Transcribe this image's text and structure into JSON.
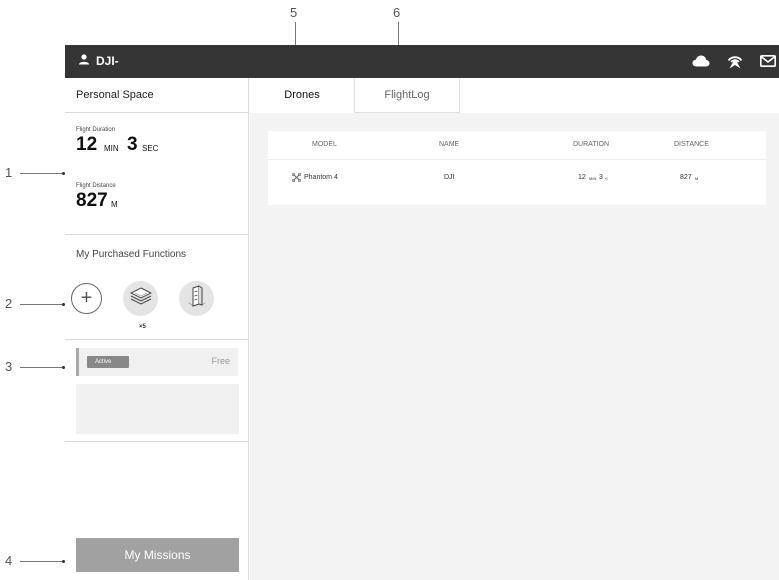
{
  "callouts": [
    "1",
    "2",
    "3",
    "4",
    "5",
    "6"
  ],
  "topbar": {
    "username": "DJI-",
    "icons": [
      "user-icon",
      "cloud-icon",
      "signal-icon",
      "mail-icon"
    ]
  },
  "sidebar": {
    "title": "Personal Space",
    "flight_duration": {
      "label": "Flight Duration",
      "minutes": "12",
      "min_unit": "MIN",
      "seconds": "3",
      "sec_unit": "SEC"
    },
    "flight_distance": {
      "label": "Flight Distance",
      "value": "827",
      "unit": "M"
    },
    "purchased_title": "My Purchased Functions",
    "purchased_count": "×5",
    "active_badge": "Active",
    "free_label": "Free",
    "my_missions_label": "My Missions"
  },
  "tabs": [
    {
      "label": "Drones",
      "active": true
    },
    {
      "label": "FlightLog",
      "active": false
    }
  ],
  "table": {
    "headers": [
      "MODEL",
      "NAME",
      "DURATION",
      "DISTANCE"
    ],
    "rows": [
      {
        "model": "Phantom 4",
        "name": "DJI",
        "dur_min": "12",
        "dur_min_unit": "MIN",
        "dur_sec": "3",
        "dur_sec_unit": "S",
        "distance": "827",
        "distance_unit": "M"
      }
    ]
  }
}
